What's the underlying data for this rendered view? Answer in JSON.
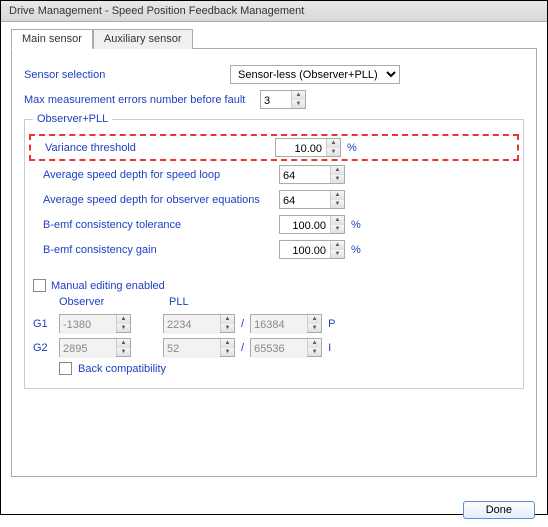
{
  "window": {
    "title": "Drive Management - Speed Position Feedback Management"
  },
  "tabs": {
    "main": "Main sensor",
    "aux": "Auxiliary sensor"
  },
  "fields": {
    "sensor_selection_label": "Sensor selection",
    "sensor_selection_value": "Sensor-less (Observer+PLL)",
    "max_errors_label": "Max measurement errors number before fault",
    "max_errors_value": "3"
  },
  "group": {
    "legend": "Observer+PLL",
    "variance_label": "Variance threshold",
    "variance_value": "10.00",
    "variance_unit": "%",
    "avg_speed_loop_label": "Average speed depth for speed loop",
    "avg_speed_loop_value": "64",
    "avg_speed_obs_label": "Average speed depth for observer equations",
    "avg_speed_obs_value": "64",
    "bemf_tol_label": "B-emf consistency tolerance",
    "bemf_tol_value": "100.00",
    "bemf_tol_unit": "%",
    "bemf_gain_label": "B-emf consistency gain",
    "bemf_gain_value": "100.00",
    "bemf_gain_unit": "%"
  },
  "manual": {
    "checkbox_label": "Manual editing enabled",
    "observer_head": "Observer",
    "pll_head": "PLL",
    "g1_label": "G1",
    "g1_obs": "-1380",
    "g1_pll_a": "2234",
    "g1_pll_b": "16384",
    "g1_suffix": "P",
    "g2_label": "G2",
    "g2_obs": "2895",
    "g2_pll_a": "52",
    "g2_pll_b": "65536",
    "g2_suffix": "I",
    "back_compat_label": "Back compatibility"
  },
  "footer": {
    "done": "Done"
  }
}
